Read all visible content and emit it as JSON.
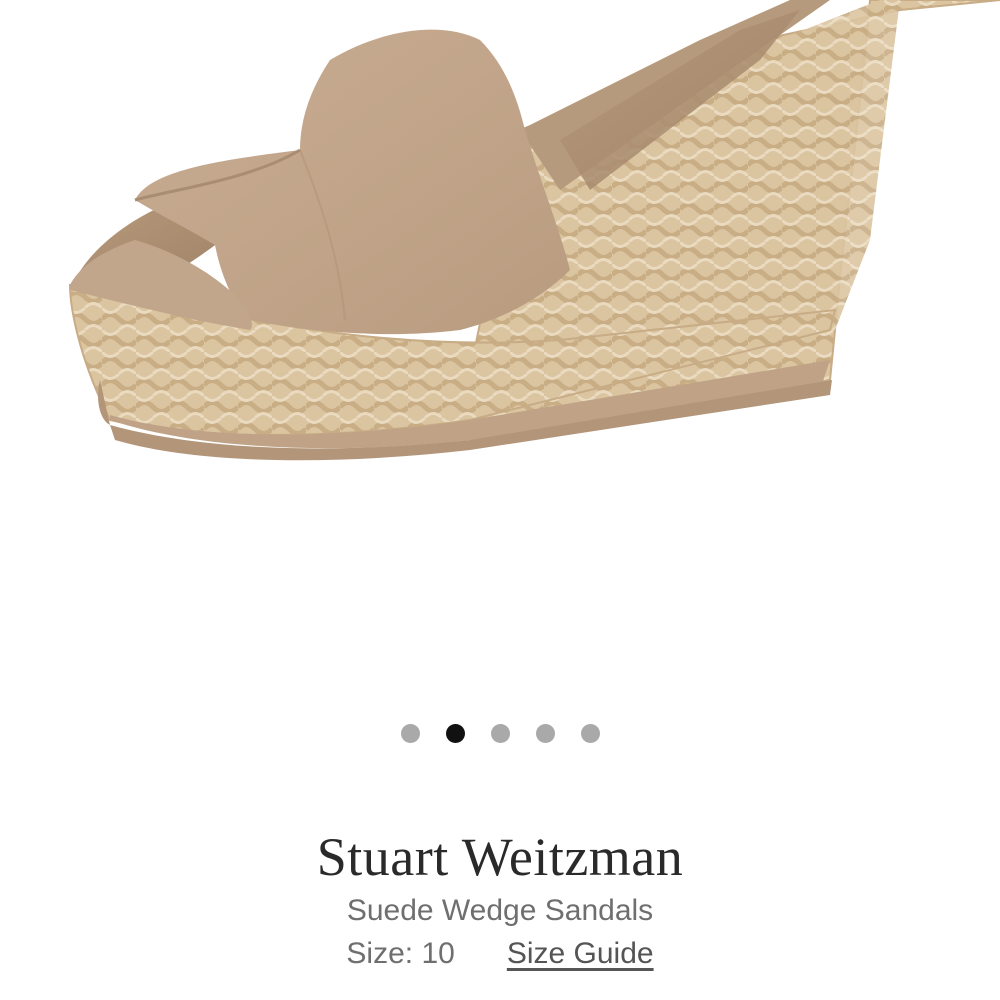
{
  "product": {
    "brand": "Stuart Weitzman",
    "name": "Suede Wedge Sandals",
    "size_text": "Size: 10",
    "size_guide_label": "Size Guide",
    "image_alt": "sandal-photo"
  },
  "carousel": {
    "total": 5,
    "active_index": 1
  },
  "colors": {
    "suede": "#c4a98f",
    "jute": "#dcc6a3",
    "active_dot": "#111111",
    "inactive_dot": "#a9a9a9"
  }
}
